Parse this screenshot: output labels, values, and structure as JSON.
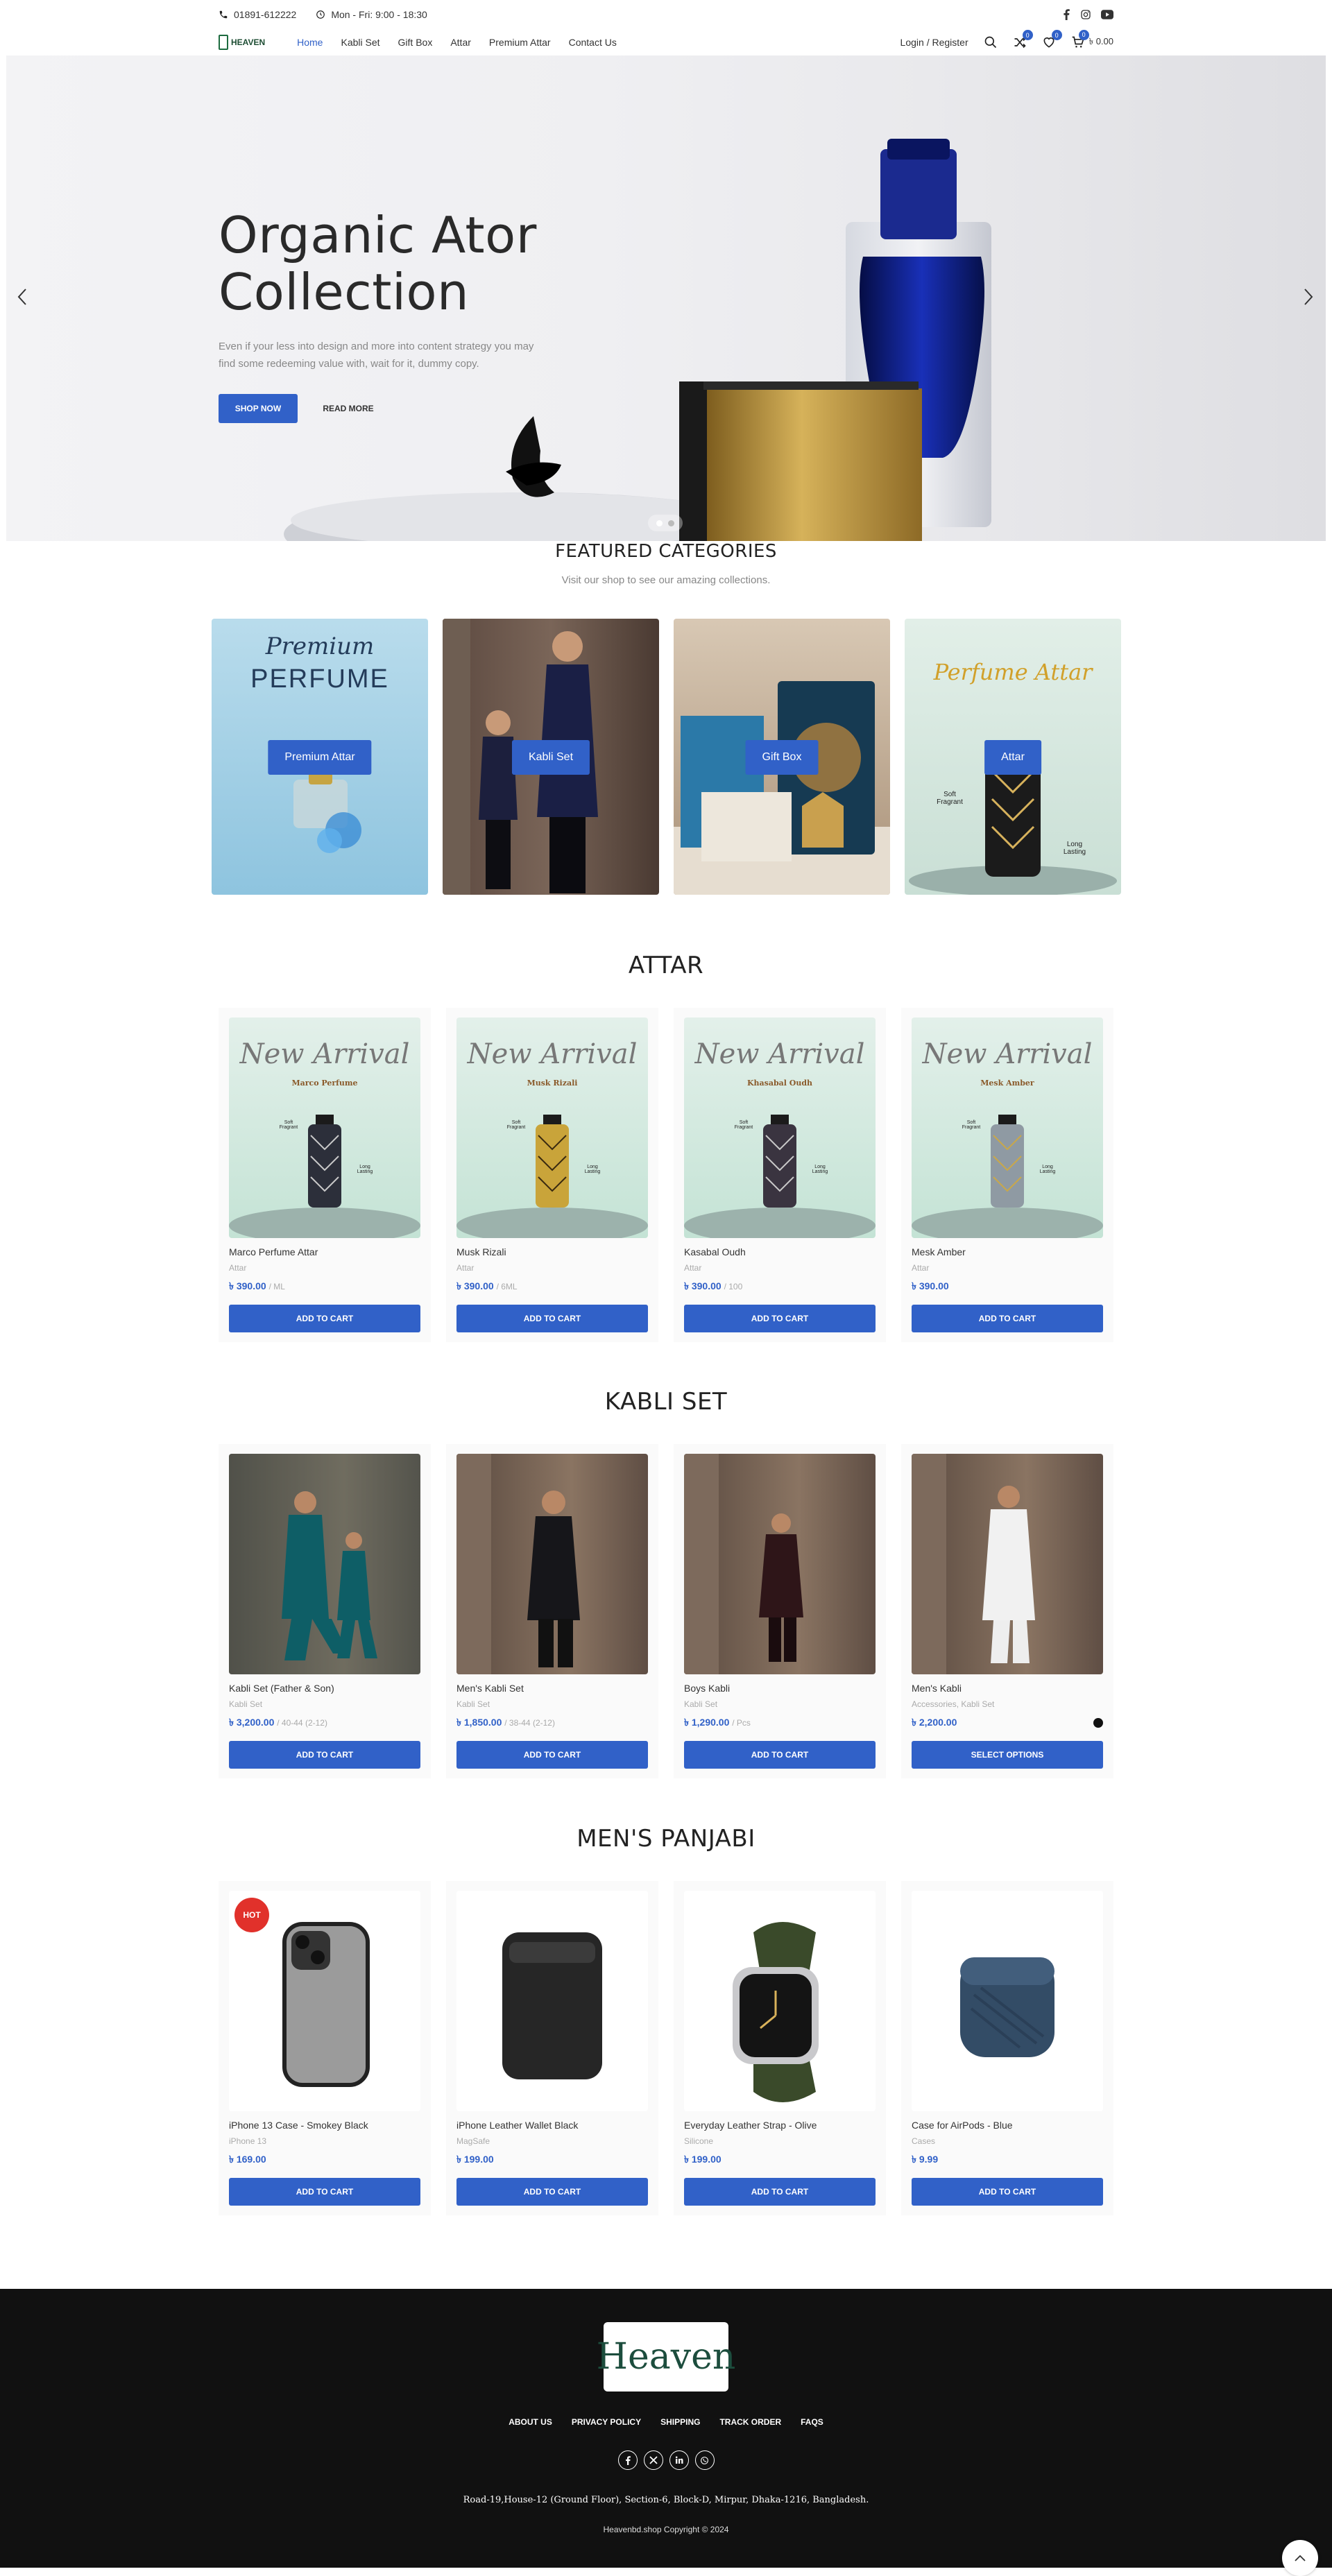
{
  "topbar": {
    "phone": "01891-612222",
    "hours": "Mon - Fri: 9:00 - 18:30"
  },
  "header": {
    "logo_text": "HEAVEN",
    "nav": [
      "Home",
      "Kabli Set",
      "Gift Box",
      "Attar",
      "Premium Attar",
      "Contact Us"
    ],
    "login": "Login / Register",
    "compare_count": "0",
    "wishlist_count": "0",
    "cart_count": "0",
    "cart_total": "৳ 0.00"
  },
  "hero": {
    "title_line1": "Organic Ator",
    "title_line2": "Collection",
    "text": "Even if your less into design and more into content strategy you may find some redeeming value with, wait for it, dummy copy.",
    "shop_now": "SHOP NOW",
    "read_more": "READ MORE"
  },
  "featured": {
    "title": "FEATURED CATEGORIES",
    "subtitle": "Visit our shop to see our amazing collections.",
    "categories": [
      {
        "label": "Premium Attar",
        "art_line1": "Premium",
        "art_line2": "PERFUME"
      },
      {
        "label": "Kabli Set"
      },
      {
        "label": "Gift Box"
      },
      {
        "label": "Attar",
        "art_line1": "Perfume Attar",
        "note1": "Soft Fragrant",
        "note2": "Long Lasting"
      }
    ]
  },
  "attar": {
    "title": "ATTAR",
    "products": [
      {
        "name": "Marco Perfume Attar",
        "category": "Attar",
        "price": "৳ 390.00",
        "unit": "/ ML",
        "button": "ADD TO CART",
        "art_title": "New Arrival",
        "art_sub": "Marco Perfume",
        "note1": "Soft Fragrant",
        "note2": "Long Lasting"
      },
      {
        "name": "Musk Rizali",
        "category": "Attar",
        "price": "৳ 390.00",
        "unit": "/ 6ML",
        "button": "ADD TO CART",
        "art_title": "New Arrival",
        "art_sub": "Musk Rizali",
        "note1": "Soft Fragrant",
        "note2": "Long Lasting"
      },
      {
        "name": "Kasabal Oudh",
        "category": "Attar",
        "price": "৳ 390.00",
        "unit": "/ 100",
        "button": "ADD TO CART",
        "art_title": "New Arrival",
        "art_sub": "Khasabal Oudh",
        "note1": "Soft Fragrant",
        "note2": "Long Lasting"
      },
      {
        "name": "Mesk Amber",
        "category": "Attar",
        "price": "৳ 390.00",
        "unit": "",
        "button": "ADD TO CART",
        "art_title": "New Arrival",
        "art_sub": "Mesk Amber",
        "note1": "Soft Fragrant",
        "note2": "Long Lasting"
      }
    ]
  },
  "kabli": {
    "title": "KABLI SET",
    "products": [
      {
        "name": "Kabli Set (Father & Son)",
        "category": "Kabli Set",
        "price": "৳ 3,200.00",
        "unit": "/ 40-44 (2-12)",
        "button": "ADD TO CART"
      },
      {
        "name": "Men's Kabli Set",
        "category": "Kabli Set",
        "price": "৳ 1,850.00",
        "unit": "/ 38-44 (2-12)",
        "button": "ADD TO CART"
      },
      {
        "name": "Boys Kabli",
        "category": "Kabli Set",
        "price": "৳ 1,290.00",
        "unit": "/ Pcs",
        "button": "ADD TO CART"
      },
      {
        "name": "Men's Kabli",
        "category": "Accessories, Kabli Set",
        "price": "৳ 2,200.00",
        "unit": "",
        "button": "SELECT OPTIONS"
      }
    ]
  },
  "panjabi": {
    "title": "MEN'S PANJABI",
    "hot": "HOT",
    "products": [
      {
        "name": "iPhone 13 Case - Smokey Black",
        "category": "iPhone 13",
        "price": "৳ 169.00",
        "button": "ADD TO CART"
      },
      {
        "name": "iPhone Leather Wallet Black",
        "category": "MagSafe",
        "price": "৳ 199.00",
        "button": "ADD TO CART"
      },
      {
        "name": "Everyday Leather Strap - Olive",
        "category": "Silicone",
        "price": "৳ 199.00",
        "button": "ADD TO CART"
      },
      {
        "name": "Case for AirPods - Blue",
        "category": "Cases",
        "price": "৳ 9.99",
        "button": "ADD TO CART"
      }
    ]
  },
  "footer": {
    "logo_text": "Heaven",
    "links": [
      "ABOUT US",
      "PRIVACY POLICY",
      "SHIPPING",
      "TRACK ORDER",
      "FAQS"
    ],
    "address": "Road-19,House-12 (Ground Floor), Section-6, Block-D, Mirpur, Dhaka-1216, Bangladesh.",
    "copyright": "Heavenbd.shop Copyright © 2024"
  },
  "colors": {
    "accent": "#3161c8",
    "hot": "#e1312b",
    "footer": "#111111"
  }
}
